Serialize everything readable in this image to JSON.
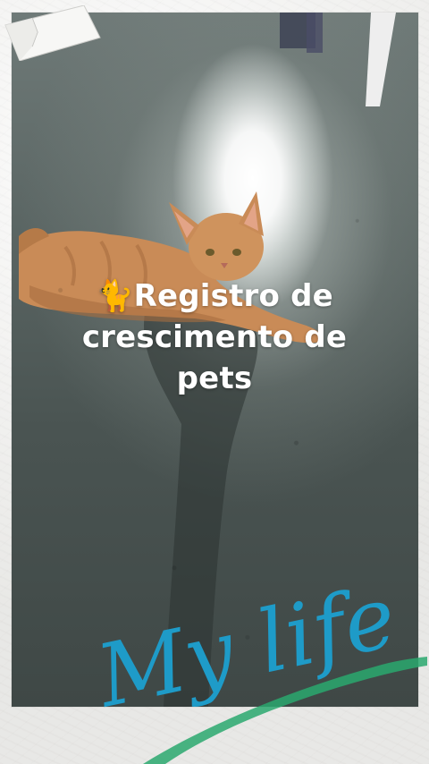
{
  "title": "🐈Registro de crescimento de pets",
  "script_caption": "My life",
  "colors": {
    "title_text": "#ffffff",
    "script_text": "#1e9bc8",
    "brush_stroke": "#2aa86f",
    "page_background": "#ecebe8"
  },
  "decorations": {
    "photo_subject": "orange-cat-icon",
    "corner_tape": "paper-tape-icon"
  }
}
